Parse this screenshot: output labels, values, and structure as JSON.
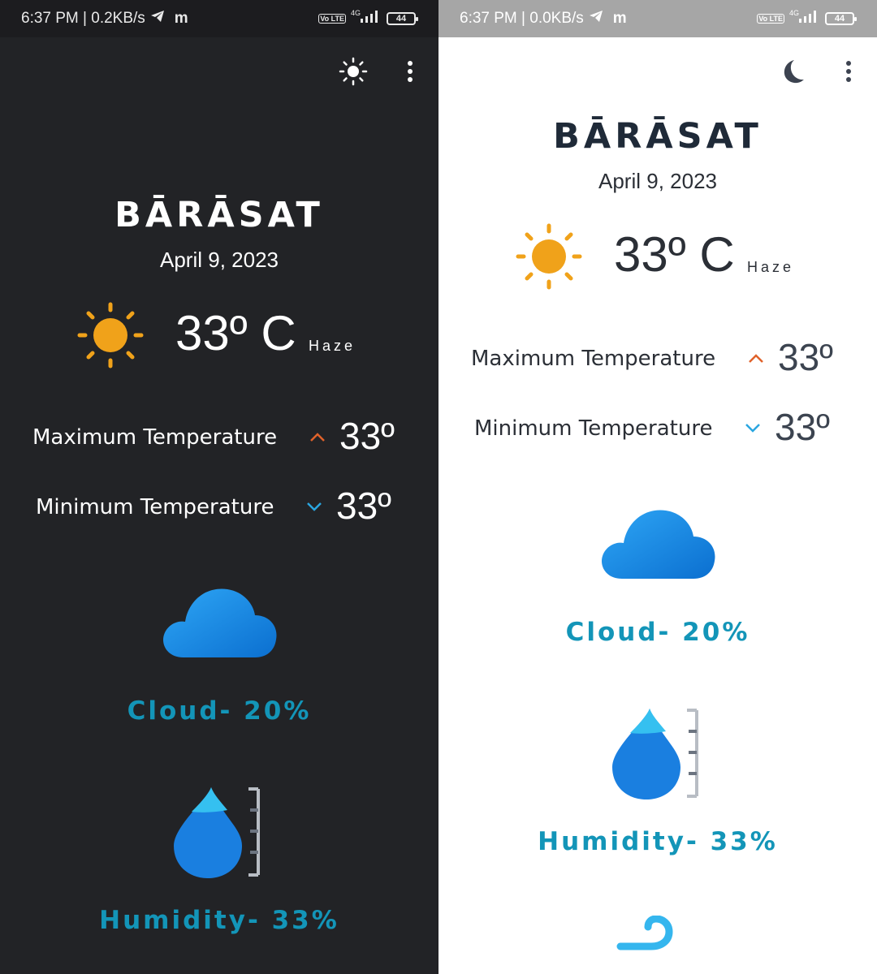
{
  "screens": [
    {
      "theme": "dark",
      "status": {
        "time_info": "6:37 PM | 0.2KB/s",
        "m": "m",
        "network": "4G",
        "volte": "Vo LTE",
        "battery": "44"
      },
      "city": "BĀRĀSAT",
      "date": "April 9, 2023",
      "temperature": "33º C",
      "condition": "Haze",
      "max_label": "Maximum Temperature",
      "max_value": "33º",
      "min_label": "Minimum Temperature",
      "min_value": "33º",
      "cloud_label": "Cloud- 20%",
      "humidity_label": "Humidity- 33%",
      "theme_icon": "sun-icon"
    },
    {
      "theme": "light",
      "status": {
        "time_info": "6:37 PM | 0.0KB/s",
        "m": "m",
        "network": "4G",
        "volte": "Vo LTE",
        "battery": "44"
      },
      "city": "BĀRĀSAT",
      "date": "April 9, 2023",
      "temperature": "33º C",
      "condition": "Haze",
      "max_label": "Maximum Temperature",
      "max_value": "33º",
      "min_label": "Minimum Temperature",
      "min_value": "33º",
      "cloud_label": "Cloud- 20%",
      "humidity_label": "Humidity- 33%",
      "theme_icon": "moon-icon"
    }
  ],
  "colors": {
    "accent_label": "#1395b8",
    "sun": "#f0a21a",
    "max_arrow": "#e0622a",
    "min_arrow": "#2aa6e0",
    "cloud": "#1e88e5"
  }
}
